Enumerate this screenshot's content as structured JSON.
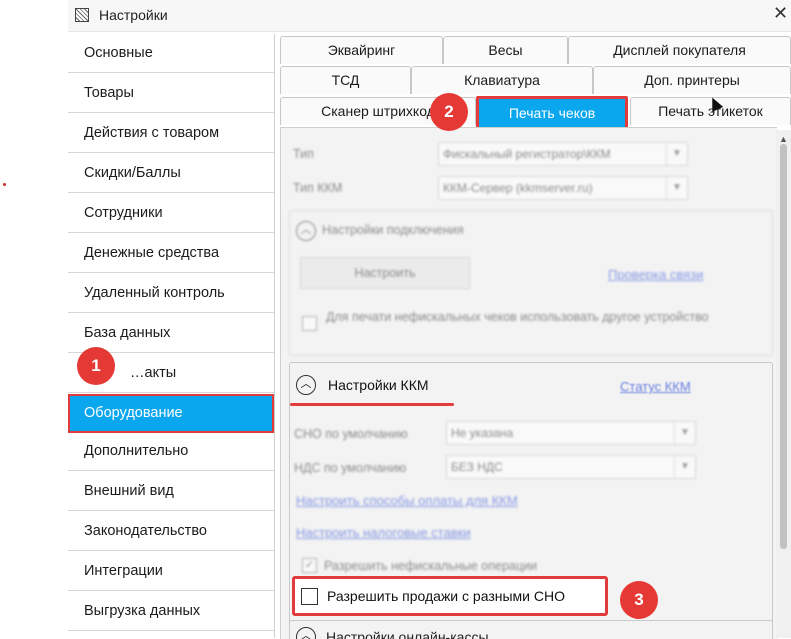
{
  "window": {
    "title": "Настройки"
  },
  "sidebar": {
    "items": [
      {
        "label": "Основные"
      },
      {
        "label": "Товары"
      },
      {
        "label": "Действия с товаром"
      },
      {
        "label": "Скидки/Баллы"
      },
      {
        "label": "Сотрудники"
      },
      {
        "label": "Денежные средства"
      },
      {
        "label": "Удаленный контроль"
      },
      {
        "label": "База данных"
      },
      {
        "label": "…акты"
      },
      {
        "label": "Оборудование",
        "active": true
      },
      {
        "label": "Дополнительно"
      },
      {
        "label": "Внешний вид"
      },
      {
        "label": "Законодательство"
      },
      {
        "label": "Интеграции"
      },
      {
        "label": "Выгрузка данных"
      }
    ]
  },
  "tabs": {
    "row1": [
      "Эквайринг",
      "Весы",
      "Дисплей покупателя"
    ],
    "row2": [
      "ТСД",
      "Клавиатура",
      "Доп. принтеры"
    ],
    "row3": [
      "Сканер штрихкод",
      "Печать чеков",
      "Печать этикеток"
    ],
    "active": "Печать чеков"
  },
  "content": {
    "type_label": "Тип",
    "type_value": "Фискальный регистратор\\ККМ",
    "kkm_type_label": "Тип ККМ",
    "kkm_type_value": "ККМ-Сервер (kkmserver.ru)",
    "connection_group": {
      "title": "Настройки подключения",
      "configure_button": "Настроить",
      "check_link": "Проверка связи",
      "other_device_checkbox": "Для печати нефискальных чеков использовать другое устройство"
    },
    "kkm_group": {
      "title": "Настройки ККМ",
      "status_link": "Статус ККМ",
      "sno_label": "СНО по умолчанию",
      "sno_value": "Не указана",
      "nds_label": "НДС по умолчанию",
      "nds_value": "БЕЗ НДС",
      "payment_methods_link": "Настроить способы оплаты для ККМ",
      "tax_rates_link": "Настроить налоговые ставки",
      "allow_nonfiscal_checkbox": "Разрешить нефискальные операции",
      "allow_mixed_sno_checkbox": "Разрешить продажи с разными СНО"
    },
    "online_group": {
      "title": "Настройки онлайн-кассы"
    }
  },
  "annotations": {
    "step1": "1",
    "step2": "2",
    "step3": "3",
    "color": "#e53935"
  },
  "colors": {
    "accent": "#0aa6ee",
    "highlight": "#e23b3b",
    "link": "#2a4bd6"
  }
}
